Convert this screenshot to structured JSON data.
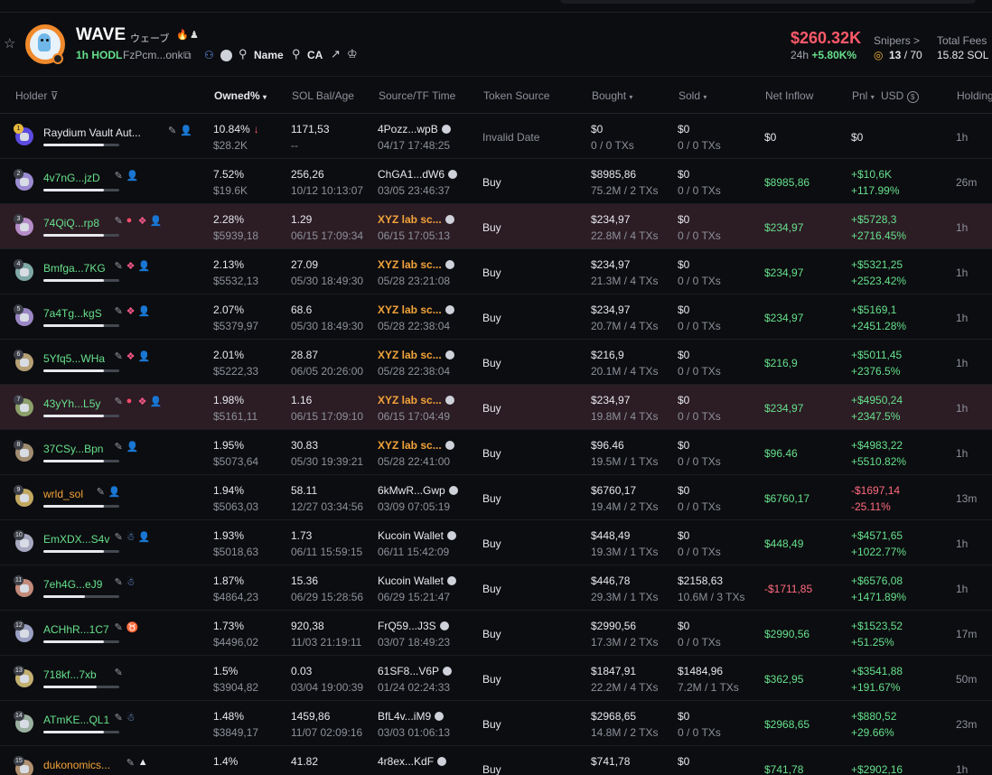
{
  "token": {
    "name": "WAVE",
    "name_jp": "ウェーブ",
    "hodl": "1h HODL",
    "address": "FzPcm...onk",
    "search_name": "Name",
    "search_ca": "CA",
    "market_cap": "$260.32K",
    "change_period": "24h",
    "change_pct": "+5.80K%",
    "snipers_label": "Snipers >",
    "snipers_value": "13",
    "snipers_total": "70",
    "fees_label": "Total Fees",
    "fees_value": "15.82 SOL"
  },
  "columns": {
    "holder": "Holder",
    "owned": "Owned%",
    "sol_bal": "SOL Bal/Age",
    "source": "Source/TF Time",
    "token_source": "Token Source",
    "bought": "Bought",
    "sold": "Sold",
    "net_inflow": "Net Inflow",
    "pnl": "Pnl",
    "usd": "USD",
    "holding": "Holding"
  },
  "rows": [
    {
      "rank": "1",
      "holder": "Raydium Vault Aut...",
      "holder_color": "white",
      "bar": 0.8,
      "icons": [
        "edit",
        "user"
      ],
      "owned": "10.84%",
      "owned_usd": "$28.2K",
      "down": true,
      "sol": "1171,53",
      "age": "--",
      "src": "4Pozz...wpB",
      "src_sol": true,
      "src_time": "04/17 17:48:25",
      "src_color": "white",
      "token_source": "Invalid Date",
      "ts_muted": true,
      "bought": "$0",
      "bought_tx": "0 / 0 TXs",
      "sold": "$0",
      "sold_tx": "0 / 0 TXs",
      "net": "$0",
      "net_color": "white",
      "pnl": "$0",
      "pnl_pct": "",
      "pnl_color": "white",
      "holding": "1h",
      "hl": false
    },
    {
      "rank": "2",
      "holder": "4v7nG...jzD",
      "holder_color": "green",
      "bar": 0.8,
      "icons": [
        "edit",
        "user"
      ],
      "owned": "7.52%",
      "owned_usd": "$19.6K",
      "sol": "256,26",
      "age": "10/12 10:13:07",
      "src": "ChGA1...dW6",
      "src_sol": true,
      "src_time": "03/05 23:46:37",
      "src_color": "white",
      "token_source": "Buy",
      "bought": "$8985,86",
      "bought_tx": "75.2M / 2 TXs",
      "sold": "$0",
      "sold_tx": "0 / 0 TXs",
      "net": "$8985,86",
      "net_color": "green",
      "pnl": "+$10,6K",
      "pnl_pct": "+117.99%",
      "pnl_color": "green",
      "holding": "26m",
      "hl": false
    },
    {
      "rank": "3",
      "holder": "74QiQ...rp8",
      "holder_color": "green",
      "bar": 0.8,
      "icons": [
        "edit",
        "warn",
        "layers",
        "user"
      ],
      "owned": "2.28%",
      "owned_usd": "$5939,18",
      "sol": "1.29",
      "age": "06/15 17:09:34",
      "src": "XYZ lab sc...",
      "src_sol": true,
      "src_time": "06/15 17:05:13",
      "src_color": "orange",
      "token_source": "Buy",
      "bought": "$234,97",
      "bought_tx": "22.8M / 4 TXs",
      "sold": "$0",
      "sold_tx": "0 / 0 TXs",
      "net": "$234,97",
      "net_color": "green",
      "pnl": "+$5728,3",
      "pnl_pct": "+2716.45%",
      "pnl_color": "green",
      "holding": "1h",
      "hl": true
    },
    {
      "rank": "4",
      "holder": "Bmfga...7KG",
      "holder_color": "green",
      "bar": 0.8,
      "icons": [
        "edit",
        "layers",
        "user"
      ],
      "owned": "2.13%",
      "owned_usd": "$5532,13",
      "sol": "27.09",
      "age": "05/30 18:49:30",
      "src": "XYZ lab sc...",
      "src_sol": true,
      "src_time": "05/28 23:21:08",
      "src_color": "orange",
      "token_source": "Buy",
      "bought": "$234,97",
      "bought_tx": "21.3M / 4 TXs",
      "sold": "$0",
      "sold_tx": "0 / 0 TXs",
      "net": "$234,97",
      "net_color": "green",
      "pnl": "+$5321,25",
      "pnl_pct": "+2523.42%",
      "pnl_color": "green",
      "holding": "1h",
      "hl": false
    },
    {
      "rank": "5",
      "holder": "7a4Tg...kgS",
      "holder_color": "green",
      "bar": 0.8,
      "icons": [
        "edit",
        "layers",
        "user"
      ],
      "owned": "2.07%",
      "owned_usd": "$5379,97",
      "sol": "68.6",
      "age": "05/30 18:49:30",
      "src": "XYZ lab sc...",
      "src_sol": true,
      "src_time": "05/28 22:38:04",
      "src_color": "orange",
      "token_source": "Buy",
      "bought": "$234,97",
      "bought_tx": "20.7M / 4 TXs",
      "sold": "$0",
      "sold_tx": "0 / 0 TXs",
      "net": "$234,97",
      "net_color": "green",
      "pnl": "+$5169,1",
      "pnl_pct": "+2451.28%",
      "pnl_color": "green",
      "holding": "1h",
      "hl": false
    },
    {
      "rank": "6",
      "holder": "5Yfq5...WHa",
      "holder_color": "green",
      "bar": 0.8,
      "icons": [
        "edit",
        "layers",
        "user"
      ],
      "owned": "2.01%",
      "owned_usd": "$5222,33",
      "sol": "28.87",
      "age": "06/05 20:26:00",
      "src": "XYZ lab sc...",
      "src_sol": true,
      "src_time": "05/28 22:38:04",
      "src_color": "orange",
      "token_source": "Buy",
      "bought": "$216,9",
      "bought_tx": "20.1M / 4 TXs",
      "sold": "$0",
      "sold_tx": "0 / 0 TXs",
      "net": "$216,9",
      "net_color": "green",
      "pnl": "+$5011,45",
      "pnl_pct": "+2376.5%",
      "pnl_color": "green",
      "holding": "1h",
      "hl": false
    },
    {
      "rank": "7",
      "holder": "43yYh...L5y",
      "holder_color": "green",
      "bar": 0.8,
      "icons": [
        "edit",
        "warn",
        "layers",
        "user"
      ],
      "owned": "1.98%",
      "owned_usd": "$5161,11",
      "sol": "1.16",
      "age": "06/15 17:09:10",
      "src": "XYZ lab sc...",
      "src_sol": true,
      "src_time": "06/15 17:04:49",
      "src_color": "orange",
      "token_source": "Buy",
      "bought": "$234,97",
      "bought_tx": "19.8M / 4 TXs",
      "sold": "$0",
      "sold_tx": "0 / 0 TXs",
      "net": "$234,97",
      "net_color": "green",
      "pnl": "+$4950,24",
      "pnl_pct": "+2347.5%",
      "pnl_color": "green",
      "holding": "1h",
      "hl": true
    },
    {
      "rank": "8",
      "holder": "37CSy...Bpn",
      "holder_color": "green",
      "bar": 0.8,
      "icons": [
        "edit",
        "user"
      ],
      "owned": "1.95%",
      "owned_usd": "$5073,64",
      "sol": "30.83",
      "age": "05/30 19:39:21",
      "src": "XYZ lab sc...",
      "src_sol": true,
      "src_time": "05/28 22:41:00",
      "src_color": "orange",
      "token_source": "Buy",
      "bought": "$96.46",
      "bought_tx": "19.5M / 1 TXs",
      "sold": "$0",
      "sold_tx": "0 / 0 TXs",
      "net": "$96.46",
      "net_color": "green",
      "pnl": "+$4983,22",
      "pnl_pct": "+5510.82%",
      "pnl_color": "green",
      "holding": "1h",
      "hl": false
    },
    {
      "rank": "9",
      "holder": "wrld_sol",
      "holder_color": "orange",
      "bar": 0.8,
      "icons": [
        "edit",
        "user"
      ],
      "owned": "1.94%",
      "owned_usd": "$5063,03",
      "sol": "58.11",
      "age": "12/27 03:34:56",
      "src": "6kMwR...Gwp",
      "src_sol": true,
      "src_time": "03/09 07:05:19",
      "src_color": "white",
      "token_source": "Buy",
      "bought": "$6760,17",
      "bought_tx": "19.4M / 2 TXs",
      "sold": "$0",
      "sold_tx": "0 / 0 TXs",
      "net": "$6760,17",
      "net_color": "green",
      "pnl": "-$1697,14",
      "pnl_pct": "-25.11%",
      "pnl_color": "red",
      "holding": "13m",
      "hl": false
    },
    {
      "rank": "10",
      "holder": "EmXDX...S4v",
      "holder_color": "green",
      "bar": 0.8,
      "icons": [
        "edit",
        "ghost",
        "user"
      ],
      "owned": "1.93%",
      "owned_usd": "$5018,63",
      "sol": "1.73",
      "age": "06/11 15:59:15",
      "src": "Kucoin Wallet",
      "src_sol": true,
      "src_time": "06/11 15:42:09",
      "src_color": "white",
      "token_source": "Buy",
      "bought": "$448,49",
      "bought_tx": "19.3M / 1 TXs",
      "sold": "$0",
      "sold_tx": "0 / 0 TXs",
      "net": "$448,49",
      "net_color": "green",
      "pnl": "+$4571,65",
      "pnl_pct": "+1022.77%",
      "pnl_color": "green",
      "holding": "1h",
      "hl": false
    },
    {
      "rank": "11",
      "holder": "7eh4G...eJ9",
      "holder_color": "green",
      "bar": 0.55,
      "icons": [
        "edit",
        "ghost"
      ],
      "owned": "1.87%",
      "owned_usd": "$4864,23",
      "sol": "15.36",
      "age": "06/29 15:28:56",
      "src": "Kucoin Wallet",
      "src_sol": true,
      "src_time": "06/29 15:21:47",
      "src_color": "white",
      "token_source": "Buy",
      "bought": "$446,78",
      "bought_tx": "29.3M / 1 TXs",
      "sold": "$2158,63",
      "sold_tx": "10.6M / 3 TXs",
      "net": "-$1711,85",
      "net_color": "red",
      "pnl": "+$6576,08",
      "pnl_pct": "+1471.89%",
      "pnl_color": "green",
      "holding": "1h",
      "hl": false
    },
    {
      "rank": "12",
      "holder": "ACHhR...1C7",
      "holder_color": "green",
      "bar": 0.8,
      "icons": [
        "edit",
        "bull"
      ],
      "owned": "1.73%",
      "owned_usd": "$4496,02",
      "sol": "920,38",
      "age": "11/03 21:19:11",
      "src": "FrQ59...J3S",
      "src_sol": true,
      "src_time": "03/07 18:49:23",
      "src_color": "white",
      "token_source": "Buy",
      "bought": "$2990,56",
      "bought_tx": "17.3M / 2 TXs",
      "sold": "$0",
      "sold_tx": "0 / 0 TXs",
      "net": "$2990,56",
      "net_color": "green",
      "pnl": "+$1523,52",
      "pnl_pct": "+51.25%",
      "pnl_color": "green",
      "holding": "17m",
      "hl": false
    },
    {
      "rank": "13",
      "holder": "718kf...7xb",
      "holder_color": "green",
      "bar": 0.7,
      "icons": [
        "edit"
      ],
      "owned": "1.5%",
      "owned_usd": "$3904,82",
      "sol": "0.03",
      "age": "03/04 19:00:39",
      "src": "61SF8...V6P",
      "src_sol": true,
      "src_time": "01/24 02:24:33",
      "src_color": "white",
      "token_source": "Buy",
      "bought": "$1847,91",
      "bought_tx": "22.2M / 4 TXs",
      "sold": "$1484,96",
      "sold_tx": "7.2M / 1 TXs",
      "net": "$362,95",
      "net_color": "green",
      "pnl": "+$3541,88",
      "pnl_pct": "+191.67%",
      "pnl_color": "green",
      "holding": "50m",
      "hl": false
    },
    {
      "rank": "14",
      "holder": "ATmKE...QL1",
      "holder_color": "green",
      "bar": 0.8,
      "icons": [
        "edit",
        "ghost"
      ],
      "owned": "1.48%",
      "owned_usd": "$3849,17",
      "sol": "1459,86",
      "age": "11/07 02:09:16",
      "src": "BfL4v...iM9",
      "src_sol": true,
      "src_time": "03/03 01:06:13",
      "src_color": "white",
      "token_source": "Buy",
      "bought": "$2968,65",
      "bought_tx": "14.8M / 2 TXs",
      "sold": "$0",
      "sold_tx": "0 / 0 TXs",
      "net": "$2968,65",
      "net_color": "green",
      "pnl": "+$880,52",
      "pnl_pct": "+29.66%",
      "pnl_color": "green",
      "holding": "23m",
      "hl": false
    },
    {
      "rank": "15",
      "holder": "dukonomics...",
      "holder_color": "orange",
      "bar": 0.8,
      "icons": [
        "edit",
        "tri"
      ],
      "owned": "1.4%",
      "owned_usd": "",
      "sol": "41.82",
      "age": "",
      "src": "4r8ex...KdF",
      "src_sol": true,
      "src_time": "",
      "src_color": "white",
      "token_source": "Buy",
      "bought": "$741,78",
      "bought_tx": "",
      "sold": "$0",
      "sold_tx": "",
      "net": "$741,78",
      "net_color": "green",
      "pnl": "+$2902,16",
      "pnl_pct": "",
      "pnl_color": "green",
      "holding": "1h",
      "hl": false
    }
  ]
}
